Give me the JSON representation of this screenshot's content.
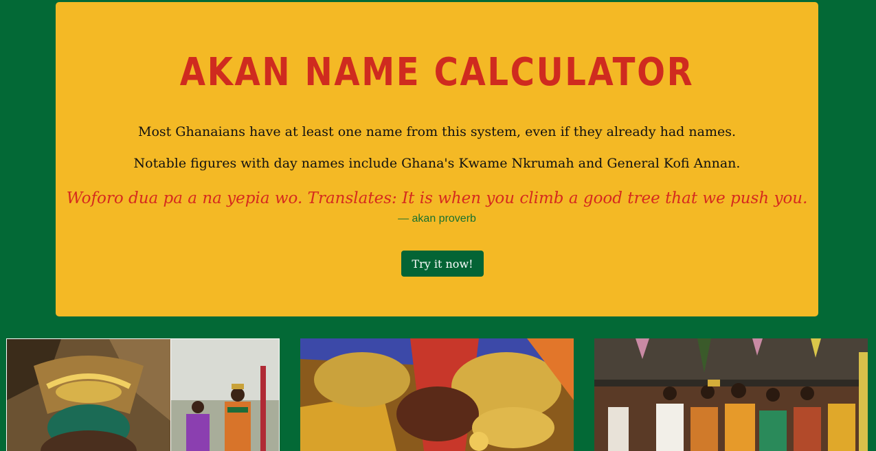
{
  "hero": {
    "title": "Akan Name Calculator",
    "paragraph_1": "Most Ghanaians have at least one name from this system, even if they already had names.",
    "paragraph_2": "Notable figures with day names include Ghana's Kwame Nkrumah and General Kofi Annan.",
    "quote": "Woforo dua pa a na yepia wo. Translates: It is when you climb a good tree that we push you.",
    "quote_author": "— akan proverb",
    "cta_label": "Try it now!"
  },
  "colors": {
    "background": "#036936",
    "hero_background": "#f4b925",
    "title": "#cf2b1f",
    "quote": "#d52a1e",
    "author": "#17702f",
    "button": "#046435"
  },
  "gallery": [
    {
      "name": "akan-chief-photo"
    },
    {
      "name": "kente-gold-jewelry-photo"
    },
    {
      "name": "akan-chiefs-gathering-photo"
    }
  ]
}
